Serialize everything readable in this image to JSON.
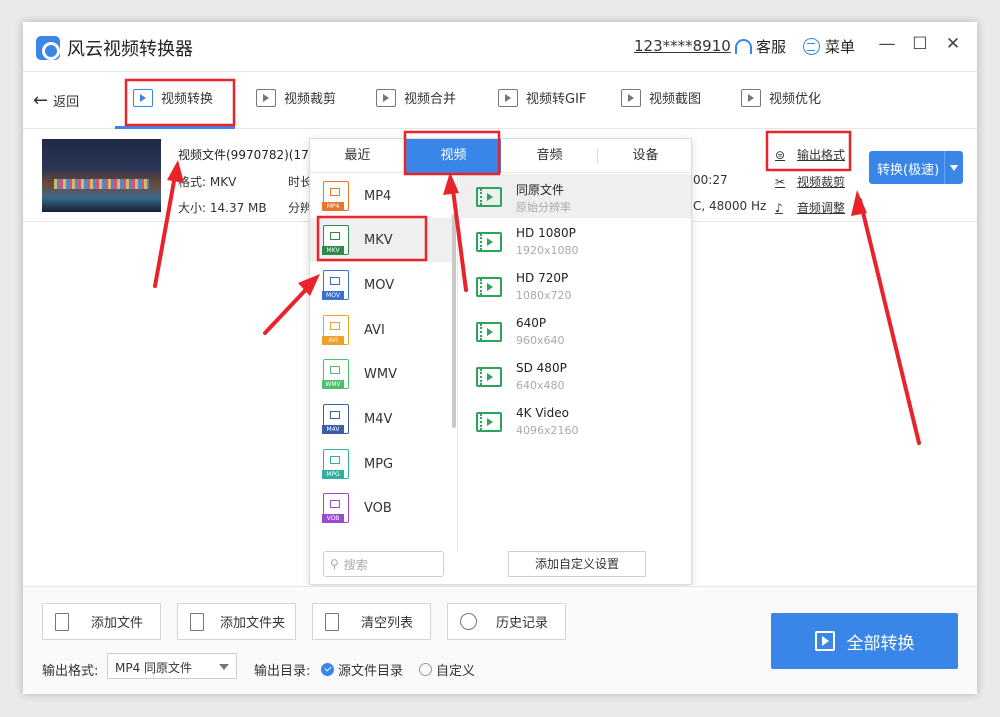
{
  "window": {
    "title": "风云视频转换器",
    "account": "123****8910",
    "service_label": "客服",
    "menu_label": "菜单",
    "minimize": "—",
    "maximize": "☐",
    "close": "✕"
  },
  "toolbar": {
    "back_label": "返回",
    "tools": [
      {
        "label": "视频转换"
      },
      {
        "label": "视频裁剪"
      },
      {
        "label": "视频合并"
      },
      {
        "label": "视频转GIF"
      },
      {
        "label": "视频截图"
      },
      {
        "label": "视频优化"
      }
    ]
  },
  "file": {
    "name": "视频文件(9970782)(17",
    "format": "格式: MKV",
    "size": "大小: 14.37 MB",
    "duration_label": "时长",
    "resolution_label": "分辨",
    "duration_value": "00:27",
    "audio_value": "C, 48000 Hz",
    "actions": {
      "output_format": "输出格式",
      "crop": "视频裁剪",
      "audio_adjust": "音频调整"
    },
    "convert_button": "转换(极速)"
  },
  "popup": {
    "tabs": [
      "最近",
      "视频",
      "音频",
      "设备"
    ],
    "active_tab": "视频",
    "formats": [
      {
        "label": "MP4",
        "color": "#e8762c"
      },
      {
        "label": "MKV",
        "color": "#2f8a4a"
      },
      {
        "label": "MOV",
        "color": "#3a6fd0"
      },
      {
        "label": "AVI",
        "color": "#f0a028"
      },
      {
        "label": "WMV",
        "color": "#4cc06a"
      },
      {
        "label": "M4V",
        "color": "#3a5ea8"
      },
      {
        "label": "MPG",
        "color": "#2fb0a0"
      },
      {
        "label": "VOB",
        "color": "#9a4ad0"
      }
    ],
    "selected_format": "MKV",
    "search_placeholder": "搜索",
    "resolutions": [
      {
        "title": "同原文件",
        "sub": "原始分辨率"
      },
      {
        "title": "HD 1080P",
        "sub": "1920x1080"
      },
      {
        "title": "HD 720P",
        "sub": "1080x720"
      },
      {
        "title": "640P",
        "sub": "960x640"
      },
      {
        "title": "SD 480P",
        "sub": "640x480"
      },
      {
        "title": "4K Video",
        "sub": "4096x2160"
      }
    ],
    "custom_button": "添加自定义设置"
  },
  "bottom": {
    "buttons": [
      "添加文件",
      "添加文件夹",
      "清空列表",
      "历史记录"
    ],
    "output_format_label": "输出格式:",
    "output_format_value": "MP4 同原文件",
    "output_dir_label": "输出目录:",
    "radio_source": "源文件目录",
    "radio_custom": "自定义",
    "convert_all": "全部转换"
  },
  "colors": {
    "accent": "#3a86e8",
    "annotation_red": "#e8242a",
    "video_icon_green": "#2ca45a"
  }
}
